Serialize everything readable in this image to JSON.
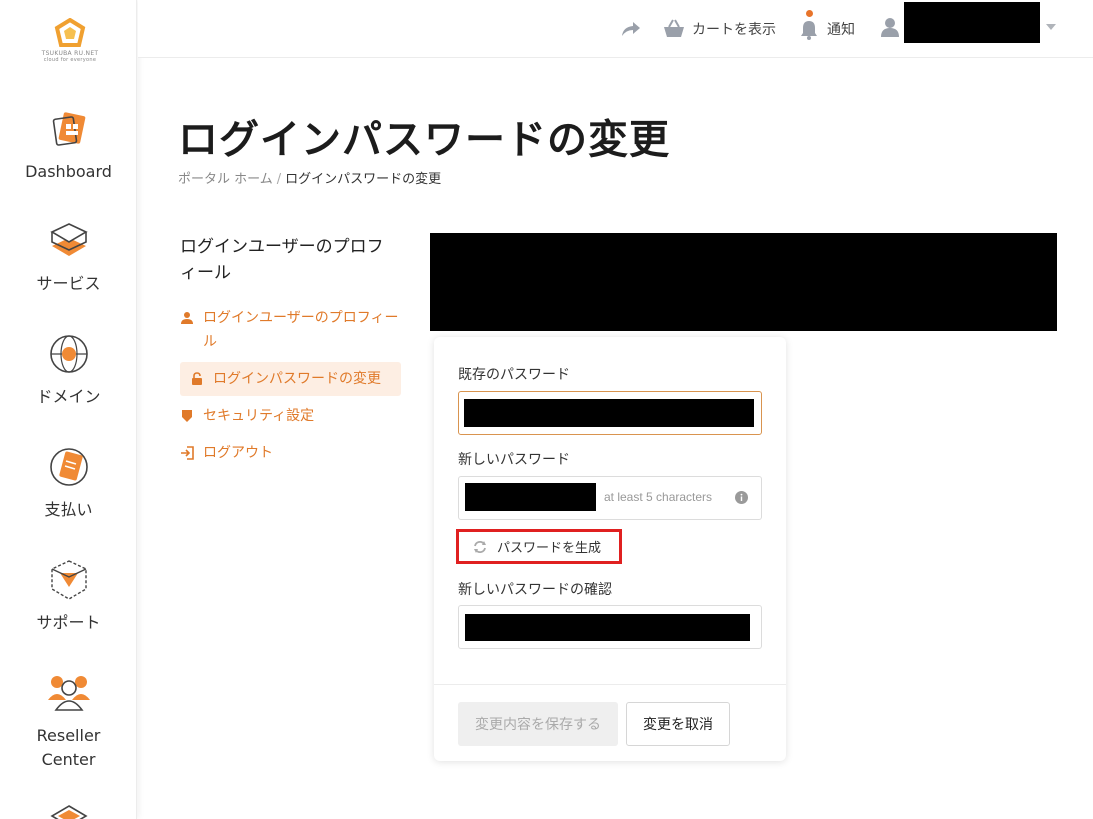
{
  "logo": {
    "text": "TSUKUBA RU.NET",
    "subtext": "cloud for everyone"
  },
  "sidebar": {
    "items": [
      {
        "label": "Dashboard",
        "icon": "dashboard-icon"
      },
      {
        "label": "サービス",
        "icon": "services-box-icon"
      },
      {
        "label": "ドメイン",
        "icon": "domain-globe-icon"
      },
      {
        "label": "支払い",
        "icon": "payment-icon"
      },
      {
        "label": "サポート",
        "icon": "support-box-icon"
      },
      {
        "label": "Reseller Center",
        "icon": "reseller-people-icon"
      }
    ]
  },
  "topbar": {
    "share_icon": "share-arrow-icon",
    "cart_label": "カートを表示",
    "notify_label": "通知",
    "user_icon": "user-icon",
    "dropdown_icon": "caret-down-icon"
  },
  "page": {
    "title": "ログインパスワードの変更",
    "breadcrumb": {
      "home": "ポータル ホーム",
      "separator": "/",
      "current": "ログインパスワードの変更"
    }
  },
  "side_menu": {
    "title": "ログインユーザーのプロフィール",
    "items": [
      {
        "label": "ログインユーザーのプロフィール",
        "icon": "user-icon"
      },
      {
        "label": "ログインパスワードの変更",
        "icon": "lock-icon",
        "active": true
      },
      {
        "label": "セキュリティ設定",
        "icon": "shield-icon"
      },
      {
        "label": "ログアウト",
        "icon": "logout-icon"
      }
    ]
  },
  "form": {
    "current_password_label": "既存のパスワード",
    "new_password_label": "新しいパスワード",
    "new_password_hint": "at least 5 characters",
    "generate_label": "パスワードを生成",
    "confirm_password_label": "新しいパスワードの確認",
    "save_label": "変更内容を保存する",
    "cancel_label": "変更を取消"
  },
  "colors": {
    "accent": "#e07a2a",
    "highlight_border": "#e02020",
    "active_bg": "#fdeee3"
  }
}
